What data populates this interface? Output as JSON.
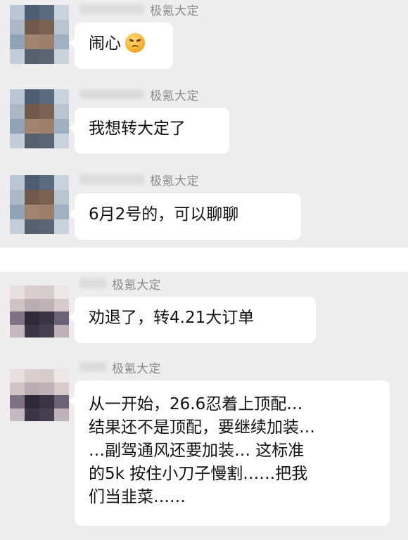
{
  "messages": [
    {
      "sender": "极氪大定",
      "lines": [
        "闹心"
      ],
      "emoji": "angry-face-icon"
    },
    {
      "sender": "极氪大定",
      "lines": [
        "我想转大定了"
      ]
    },
    {
      "sender": "极氪大定",
      "lines": [
        "6月2号的，可以聊聊"
      ]
    },
    {
      "sender": "极氪大定",
      "lines": [
        "劝退了，转4.21大订单"
      ]
    },
    {
      "sender": "极氪大定",
      "lines": [
        "从一开始，26.6忍着上顶配…",
        "结果还不是顶配，要继续加装…",
        "…副驾通风还要加装… 这标准",
        "的5k 按住小刀子慢割……把我",
        "们当韭菜……"
      ]
    }
  ],
  "colors": {
    "background": "#ededed",
    "bubble": "#ffffff",
    "sender_text": "#8a8a8a",
    "message_text": "#111111"
  }
}
